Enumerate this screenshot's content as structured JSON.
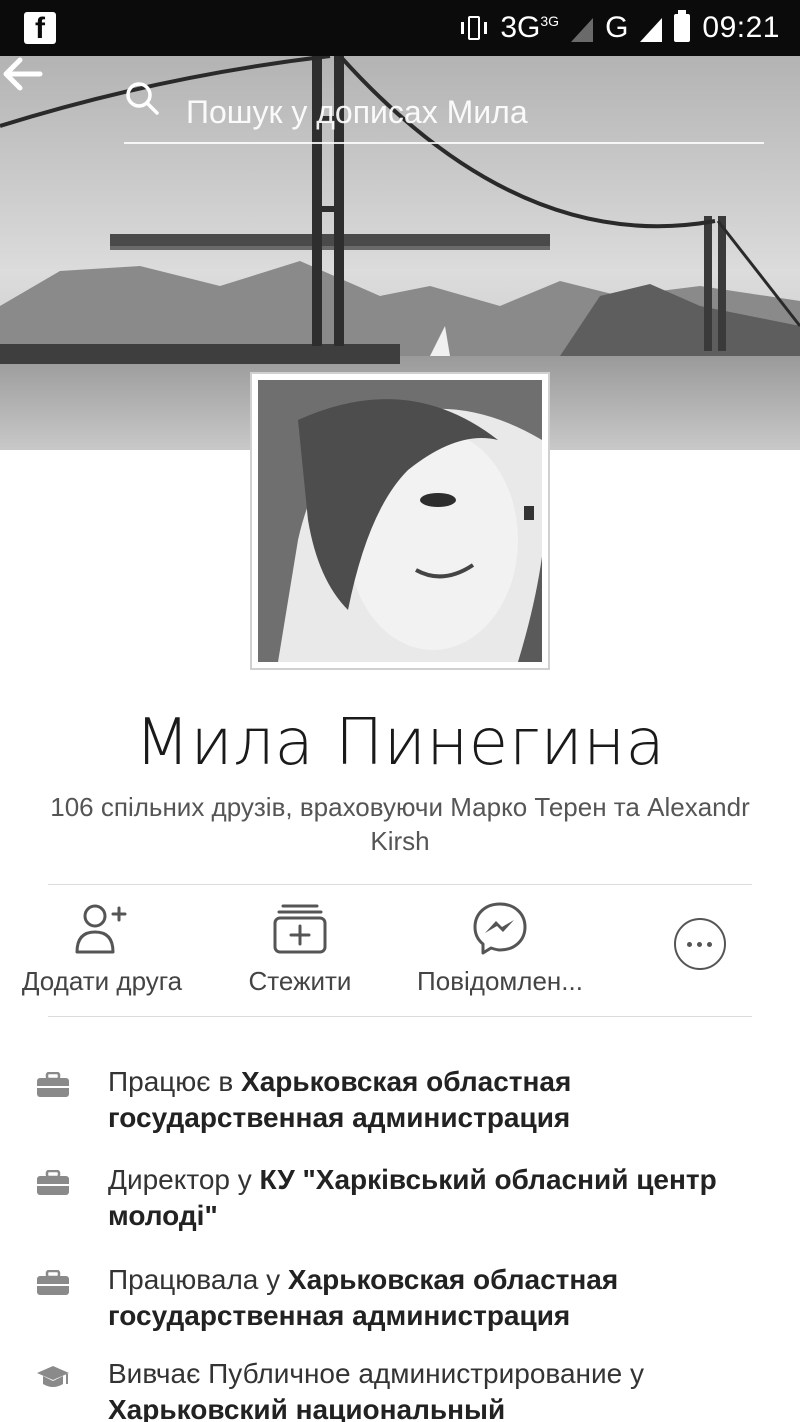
{
  "status_bar": {
    "network": "3G",
    "network_sup": "3G",
    "network2": "G",
    "time": "09:21"
  },
  "search": {
    "placeholder": "Пошук у дописах Мила"
  },
  "profile": {
    "name": "Мила Пинегина",
    "mutual_friends": "106 спільних друзів, враховуючи Марко Терен та Alexandr Kirsh"
  },
  "actions": [
    {
      "label": "Додати друга",
      "icon": "add-friend-icon"
    },
    {
      "label": "Стежити",
      "icon": "follow-icon"
    },
    {
      "label": "Повідомлен...",
      "icon": "messenger-icon"
    },
    {
      "label": "",
      "icon": "more-icon"
    }
  ],
  "info": [
    {
      "icon": "briefcase-icon",
      "prefix": "Працює в ",
      "bold": "Харьковская областная государственная администрация"
    },
    {
      "icon": "briefcase-icon",
      "prefix": "Директор у ",
      "bold": "КУ \"Харківський обласний центр молоді\""
    },
    {
      "icon": "briefcase-icon",
      "prefix": "Працювала у ",
      "bold": "Харьковская областная государственная администрация"
    },
    {
      "icon": "graduation-cap-icon",
      "prefix": "Вивчає Публичное администрирование у ",
      "bold": "Харьковский национальный"
    }
  ]
}
